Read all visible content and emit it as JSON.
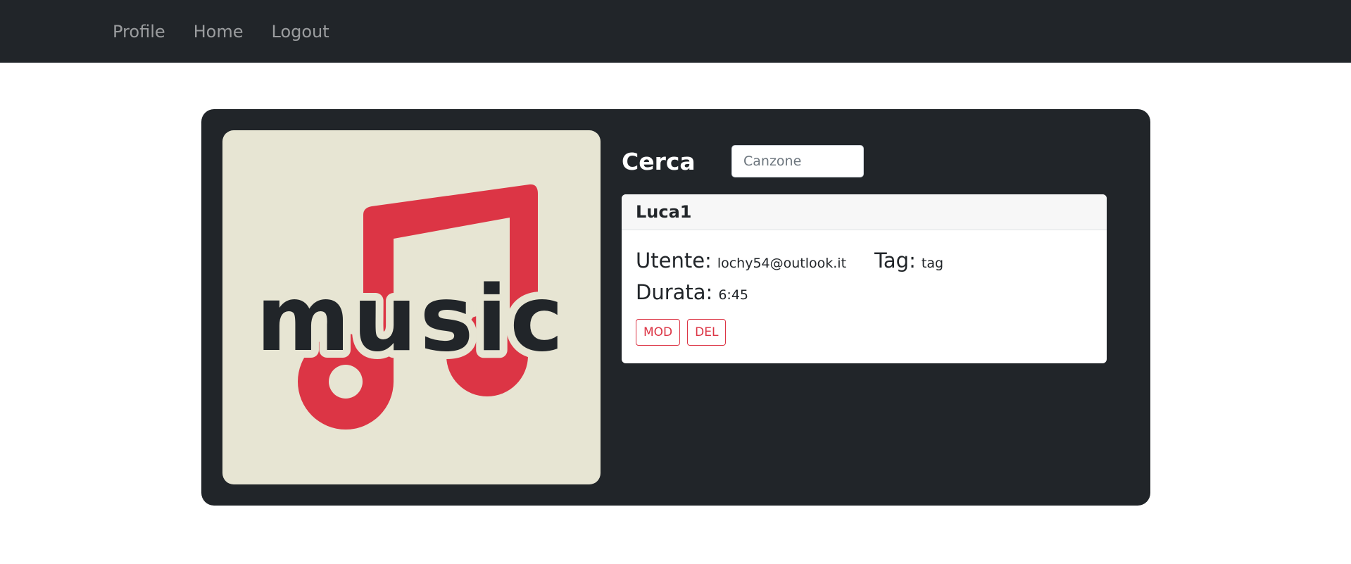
{
  "nav": {
    "items": [
      {
        "label": "Profile"
      },
      {
        "label": "Home"
      },
      {
        "label": "Logout"
      }
    ]
  },
  "cover": {
    "logo_text": "music",
    "colors": {
      "background": "#e7e5d3",
      "note": "#dc3545",
      "text": "#212529"
    },
    "icon": "music-note-icon"
  },
  "search": {
    "label": "Cerca",
    "placeholder": "Canzone",
    "value": ""
  },
  "song": {
    "title": "Luca1",
    "utente_label": "Utente:",
    "utente_value": "lochy54@outlook.it",
    "tag_label": "Tag:",
    "tag_value": "tag",
    "durata_label": "Durata:",
    "durata_value": "6:45",
    "mod_label": "MOD",
    "del_label": "DEL"
  },
  "colors": {
    "navbar": "#212529",
    "card": "#212529",
    "danger": "#dc3545"
  }
}
